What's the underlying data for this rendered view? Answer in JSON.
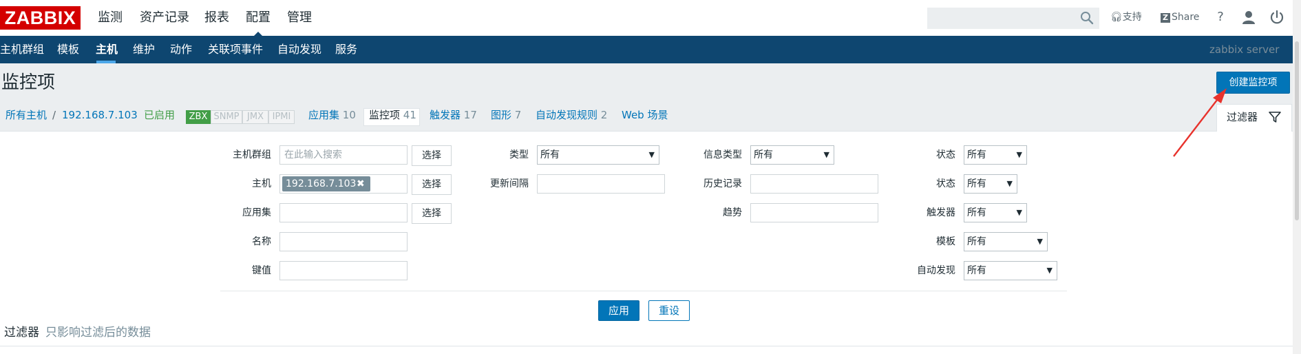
{
  "header": {
    "logo": "ZABBIX",
    "nav": [
      "监测",
      "资产记录",
      "报表",
      "配置",
      "管理"
    ],
    "active_nav": "配置",
    "support_label": "支持",
    "share_label": "Share",
    "help_label": "?"
  },
  "subnav": {
    "items": [
      "主机群组",
      "模板",
      "主机",
      "维护",
      "动作",
      "关联项事件",
      "自动发现",
      "服务"
    ],
    "active": "主机",
    "server_name": "zabbix server"
  },
  "page": {
    "title": "监控项",
    "create_button": "创建监控项"
  },
  "breadcrumb": {
    "all_hosts": "所有主机",
    "separator": "/",
    "host": "192.168.7.103",
    "status": "已启用",
    "badges": [
      "ZBX",
      "SNMP",
      "JMX",
      "IPMI"
    ],
    "tabs": [
      {
        "label": "应用集",
        "count": "10"
      },
      {
        "label": "监控项",
        "count": "41"
      },
      {
        "label": "触发器",
        "count": "17"
      },
      {
        "label": "图形",
        "count": "7"
      },
      {
        "label": "自动发现规则",
        "count": "2"
      },
      {
        "label": "Web 场景",
        "count": ""
      }
    ],
    "filter_tab": "过滤器"
  },
  "filter": {
    "col1": {
      "host_group_label": "主机群组",
      "host_group_placeholder": "在此输入搜索",
      "host_label": "主机",
      "host_value": "192.168.7.103",
      "chip_remove": "✖",
      "app_label": "应用集",
      "name_label": "名称",
      "key_label": "键值",
      "select_button": "选择"
    },
    "col2": {
      "type_label": "类型",
      "type_value": "所有",
      "interval_label": "更新间隔"
    },
    "col3": {
      "info_type_label": "信息类型",
      "info_type_value": "所有",
      "history_label": "历史记录",
      "trends_label": "趋势"
    },
    "col4": {
      "state_label": "状态",
      "state_value": "所有",
      "status_label": "状态",
      "status_value": "所有",
      "triggers_label": "触发器",
      "triggers_value": "所有",
      "template_label": "模板",
      "template_value": "所有",
      "discovery_label": "自动发现",
      "discovery_value": "所有"
    },
    "apply_button": "应用",
    "reset_button": "重设"
  },
  "result": {
    "title": "过滤器",
    "subtitle": "只影响过滤后的数据"
  },
  "colors": {
    "brand_red": "#d40000",
    "nav_blue": "#0e4670",
    "accent_blue": "#0275b8",
    "status_green": "#429e47",
    "annotation_red": "#e8322c"
  }
}
